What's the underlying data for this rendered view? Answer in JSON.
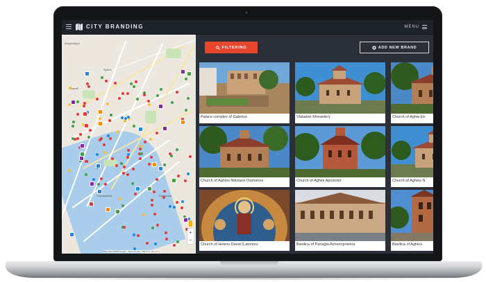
{
  "app": {
    "brand": "CITY BRANDING",
    "menu_label": "MENU"
  },
  "toolbar": {
    "filter_label": "FILTERING",
    "add_label": "ADD NEW BRAND"
  },
  "map": {
    "labels": [
      "Ampelokipoi",
      "Sykies",
      "Neapoli",
      "Kalamaria",
      "Thessaloniki"
    ],
    "attribution": "Map data ©2016 Google · Terms of Use · Report a map error"
  },
  "cards": [
    {
      "caption": "Palace complex of Galerius",
      "theme": "ruins"
    },
    {
      "caption": "Vlatadon Monastery",
      "theme": "church-sky"
    },
    {
      "caption": "Church of Aghia Ek",
      "theme": "church-trees"
    },
    {
      "caption": "Church of Aghios Nikolaos Orphanos",
      "theme": "church-trees"
    },
    {
      "caption": "Church of Aghioi Apostoloi",
      "theme": "church-red"
    },
    {
      "caption": "Church of Aghios N",
      "theme": "church-sky"
    },
    {
      "caption": "Church of Hosios David (Latomou",
      "theme": "fresco"
    },
    {
      "caption": "Basilica of Panagia Acheiropoietos",
      "theme": "basilica"
    },
    {
      "caption": "Basilica of Aghios",
      "theme": "tower"
    }
  ],
  "colors": {
    "accent": "#e8452f",
    "topbar": "#1e2229",
    "content_bg": "#2b3038"
  }
}
